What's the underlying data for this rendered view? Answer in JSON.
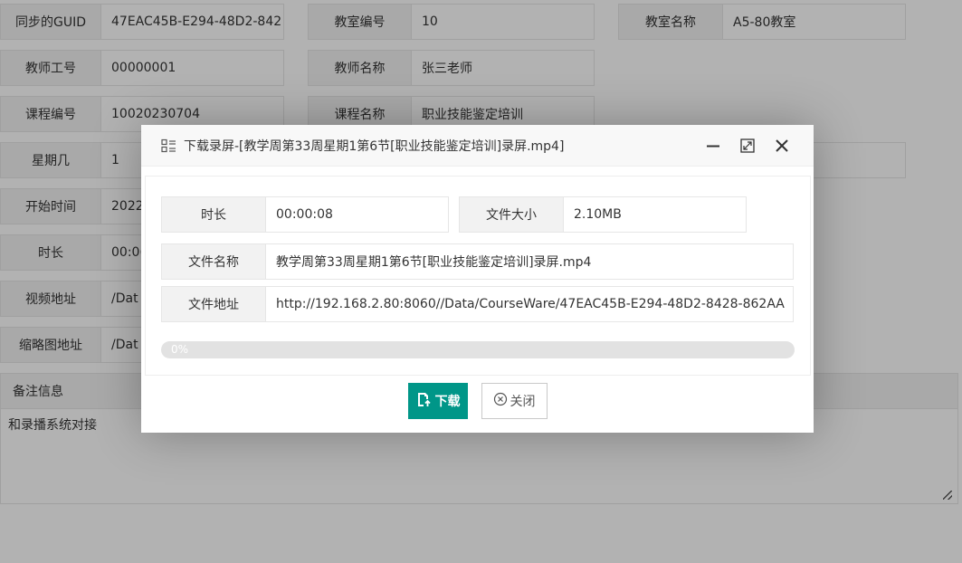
{
  "form": {
    "sync_guid": {
      "label": "同步的GUID",
      "value": "47EAC45B-E294-48D2-842"
    },
    "classroom_no": {
      "label": "教室编号",
      "value": "10"
    },
    "classroom_name": {
      "label": "教室名称",
      "value": "A5-80教室"
    },
    "teacher_id": {
      "label": "教师工号",
      "value": "00000001"
    },
    "teacher_name": {
      "label": "教师名称",
      "value": "张三老师"
    },
    "course_no": {
      "label": "课程编号",
      "value": "10020230704"
    },
    "course_name": {
      "label": "课程名称",
      "value": "职业技能鉴定培训"
    },
    "weekday": {
      "label": "星期几",
      "value": "1"
    },
    "start_time": {
      "label": "开始时间",
      "value": "2022"
    },
    "duration": {
      "label": "时长",
      "value": "00:0("
    },
    "video_url": {
      "label": "视频地址",
      "value": "/Dat"
    },
    "thumb_url": {
      "label": "缩略图地址",
      "value": "/Dat"
    },
    "remarks": {
      "label": "备注信息",
      "value": "和录播系统对接"
    }
  },
  "dialog": {
    "title": "下载录屏-[教学周第33周星期1第6节[职业技能鉴定培训]录屏.mp4]",
    "duration": {
      "label": "时长",
      "value": "00:00:08"
    },
    "file_size": {
      "label": "文件大小",
      "value": "2.10MB"
    },
    "file_name": {
      "label": "文件名称",
      "value": "教学周第33周星期1第6节[职业技能鉴定培训]录屏.mp4"
    },
    "file_url": {
      "label": "文件地址",
      "value": "http://192.168.2.80:8060//Data/CourseWare/47EAC45B-E294-48D2-8428-862AA"
    },
    "progress": {
      "percent": 0,
      "text": "0%"
    },
    "download_label": "下载",
    "close_label": "关闭"
  },
  "colors": {
    "primary": "#009688",
    "shade": "rgba(0,0,0,0.3)"
  },
  "icons": {
    "title": "list-icon",
    "minimize": "minimize-icon",
    "maximize": "maximize-icon",
    "close": "close-icon",
    "download": "download-file-icon",
    "close_button": "close-circle-icon"
  }
}
